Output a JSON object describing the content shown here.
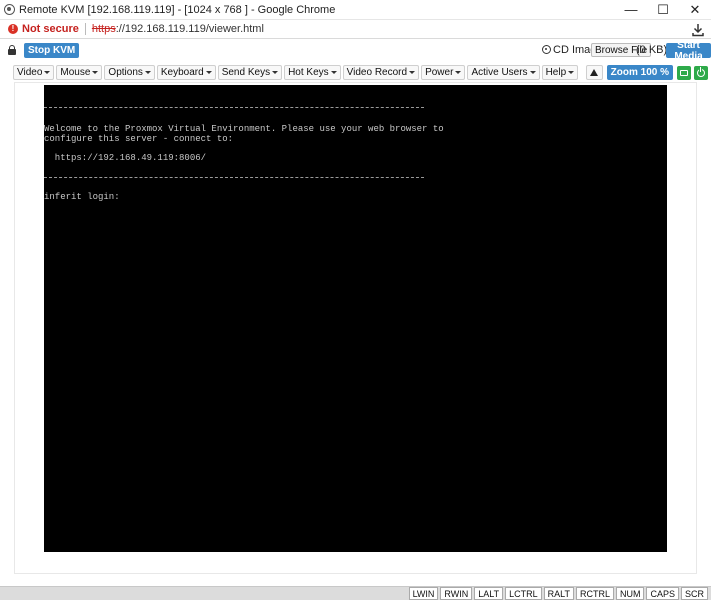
{
  "window": {
    "title": "Remote KVM [192.168.119.119] - [1024 x 768 ] - Google Chrome",
    "minimize": "—",
    "maximize": "☐",
    "close": "✕"
  },
  "address": {
    "security_label": "Not secure",
    "url_scheme": "https",
    "url_rest": "://192.168.119.119/viewer.html"
  },
  "kvm_header": {
    "stop_label": "Stop KVM",
    "cd_label": "CD Image:",
    "browse_label": "Browse File",
    "size_label": "(0 KB)",
    "start_media_label": "Start Media"
  },
  "toolbar": {
    "menus": [
      "Video",
      "Mouse",
      "Options",
      "Keyboard",
      "Send Keys",
      "Hot Keys",
      "Video Record",
      "Power",
      "Active Users",
      "Help"
    ],
    "zoom_label": "Zoom 100 %"
  },
  "console": {
    "line1": "Welcome to the Proxmox Virtual Environment. Please use your web browser to",
    "line2": "configure this server - connect to:",
    "url": "  https://192.168.49.119:8006/",
    "login": "inferit login:"
  },
  "statusbar": {
    "keys": [
      "LWIN",
      "RWIN",
      "LALT",
      "LCTRL",
      "RALT",
      "RCTRL",
      "NUM",
      "CAPS",
      "SCR"
    ]
  },
  "colors": {
    "accent": "#3a87c8",
    "green": "#2eaa4a",
    "warning": "#c5221f",
    "console_bg": "#000000"
  },
  "icons": [
    "chrome-app-icon",
    "not-secure-icon",
    "download-icon",
    "lock-icon",
    "cd-icon",
    "warning-icon",
    "monitor-icon",
    "power-icon"
  ]
}
